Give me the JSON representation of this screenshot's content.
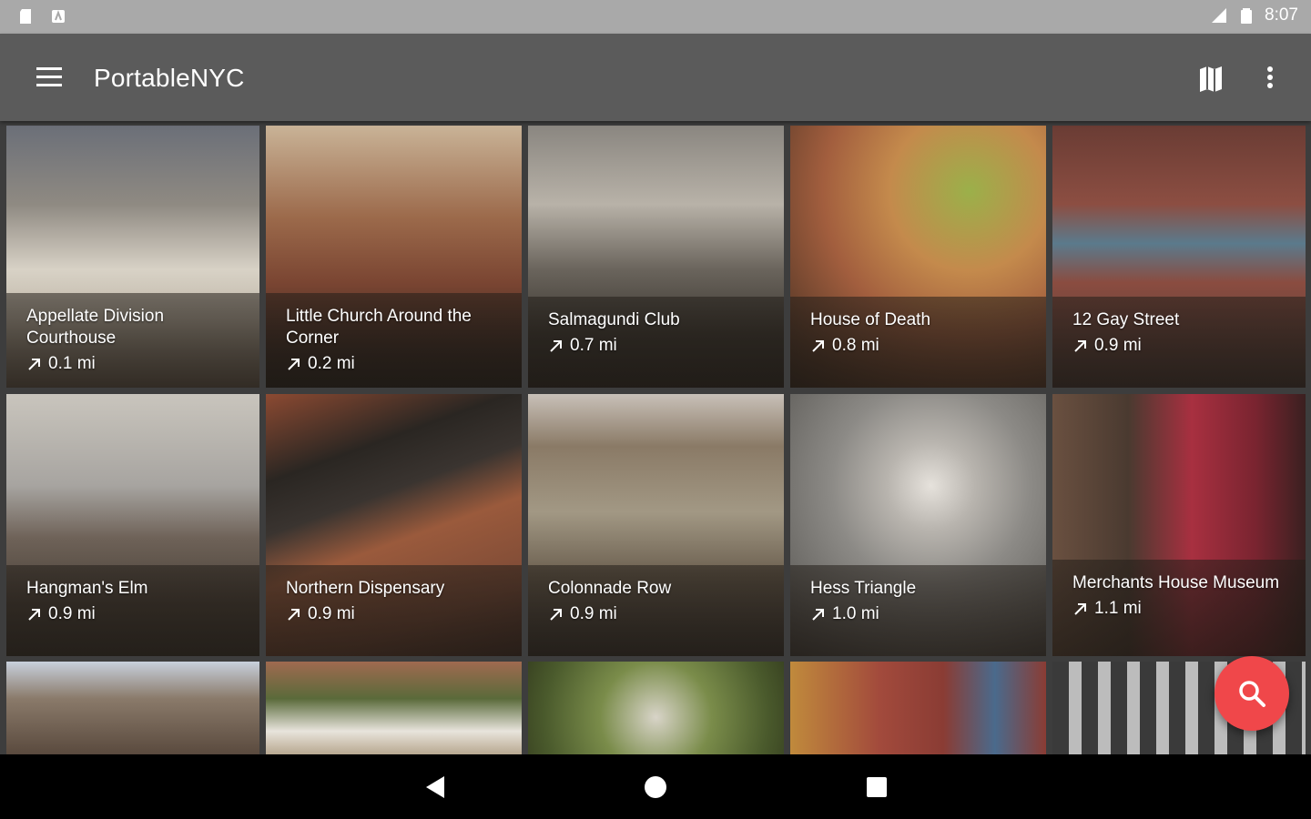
{
  "status_bar": {
    "time": "8:07",
    "icons": [
      "sd-card-icon",
      "notification-icon",
      "signal-icon",
      "battery-icon"
    ]
  },
  "app_bar": {
    "title": "PortableNYC",
    "icons": [
      "menu-icon",
      "map-icon",
      "more-vert-icon"
    ]
  },
  "colors": {
    "status_bar": "#a9a9a9",
    "app_bar": "#5b5b5b",
    "fab": "#f0474a",
    "nav_bar": "#000000"
  },
  "places": [
    {
      "name": "Appellate Division Courthouse",
      "distance": "0.1 mi"
    },
    {
      "name": "Little Church Around the Corner",
      "distance": "0.2 mi"
    },
    {
      "name": "Salmagundi Club",
      "distance": "0.7 mi"
    },
    {
      "name": "House of Death",
      "distance": "0.8 mi"
    },
    {
      "name": "12 Gay Street",
      "distance": "0.9 mi"
    },
    {
      "name": "Hangman's Elm",
      "distance": "0.9 mi"
    },
    {
      "name": "Northern Dispensary",
      "distance": "0.9 mi"
    },
    {
      "name": "Colonnade Row",
      "distance": "0.9 mi"
    },
    {
      "name": "Hess Triangle",
      "distance": "1.0 mi"
    },
    {
      "name": "Merchants House Museum",
      "distance": "1.1 mi"
    }
  ],
  "fab": {
    "icon": "search-icon"
  },
  "nav_bar": {
    "icons": [
      "back-icon",
      "home-icon",
      "recents-icon"
    ]
  }
}
